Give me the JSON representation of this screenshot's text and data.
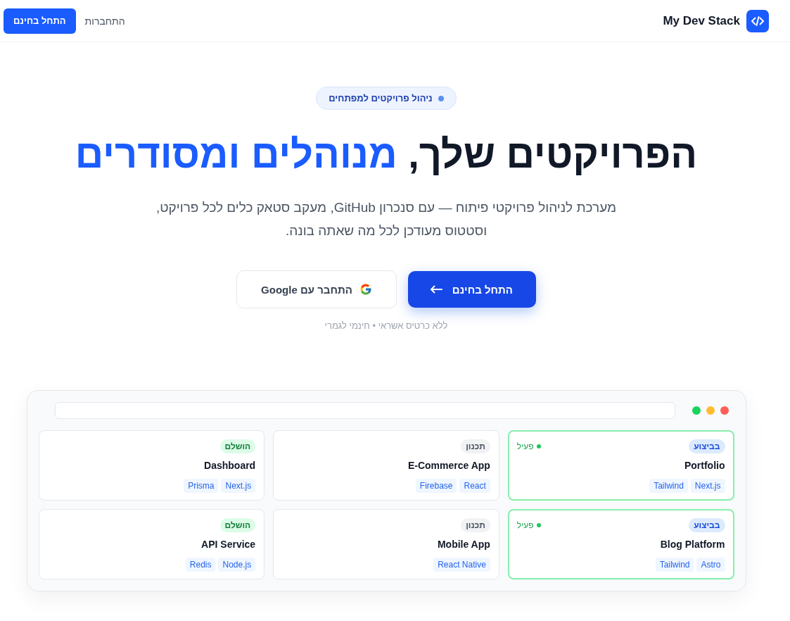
{
  "header": {
    "logo_text": "My Dev Stack",
    "login_link": "התחברות",
    "cta_button": "התחל בחינם"
  },
  "hero": {
    "badge": "ניהול פרויקטים למפתחים",
    "title_start": "הפרויקטים שלך,",
    "title_highlight": "מנוהלים ומסודרים",
    "subtitle": "מערכת לניהול פרויקטי פיתוח — עם סנכרון GitHub, מעקב סטאק כלים לכל פרויקט, וסטטוס מעודכן לכל מה שאתה בונה.",
    "primary_button": "התחל בחינם",
    "google_button": "התחבר עם Google",
    "note": "ללא כרטיס אשראי • חינמי לגמרי"
  },
  "preview": {
    "projects": [
      {
        "name": "Portfolio",
        "status": {
          "kind": "in_progress",
          "label": "בביצוע"
        },
        "active": true,
        "active_label": "פעיל",
        "tags": [
          "Next.js",
          "Tailwind"
        ]
      },
      {
        "name": "E-Commerce App",
        "status": {
          "kind": "planning",
          "label": "תכנון"
        },
        "active": false,
        "tags": [
          "React",
          "Firebase"
        ]
      },
      {
        "name": "Dashboard",
        "status": {
          "kind": "done",
          "label": "הושלם"
        },
        "active": false,
        "tags": [
          "Next.js",
          "Prisma"
        ]
      },
      {
        "name": "Blog Platform",
        "status": {
          "kind": "in_progress",
          "label": "בביצוע"
        },
        "active": true,
        "active_label": "פעיל",
        "tags": [
          "Astro",
          "Tailwind"
        ]
      },
      {
        "name": "Mobile App",
        "status": {
          "kind": "planning",
          "label": "תכנון"
        },
        "active": false,
        "tags": [
          "React Native"
        ]
      },
      {
        "name": "API Service",
        "status": {
          "kind": "done",
          "label": "הושלם"
        },
        "active": false,
        "tags": [
          "Node.js",
          "Redis"
        ]
      }
    ]
  }
}
